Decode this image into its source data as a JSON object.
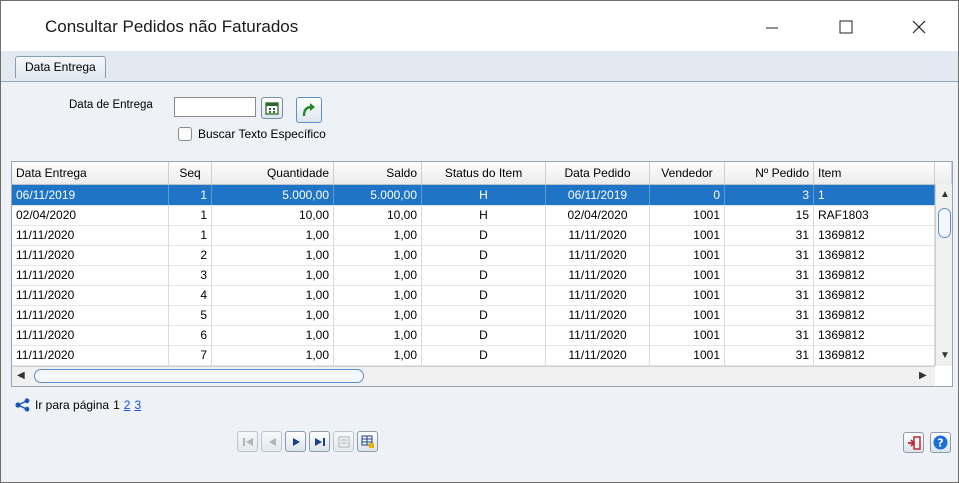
{
  "window": {
    "title": "Consultar Pedidos não Faturados"
  },
  "tabs": [
    {
      "label": "Data Entrega"
    }
  ],
  "filter": {
    "date_label": "Data de Entrega",
    "date_value": "",
    "checkbox_label": "Buscar Texto Específico",
    "checkbox_checked": false
  },
  "grid": {
    "columns": [
      "Data Entrega",
      "Seq",
      "Quantidade",
      "Saldo",
      "Status do Item",
      "Data Pedido",
      "Vendedor",
      "Nº Pedido",
      "Item"
    ],
    "rows": [
      [
        "06/11/2019",
        "1",
        "5.000,00",
        "5.000,00",
        "H",
        "06/11/2019",
        "0",
        "3",
        "1"
      ],
      [
        "02/04/2020",
        "1",
        "10,00",
        "10,00",
        "H",
        "02/04/2020",
        "1001",
        "15",
        "RAF1803"
      ],
      [
        "11/11/2020",
        "1",
        "1,00",
        "1,00",
        "D",
        "11/11/2020",
        "1001",
        "31",
        "1369812"
      ],
      [
        "11/11/2020",
        "2",
        "1,00",
        "1,00",
        "D",
        "11/11/2020",
        "1001",
        "31",
        "1369812"
      ],
      [
        "11/11/2020",
        "3",
        "1,00",
        "1,00",
        "D",
        "11/11/2020",
        "1001",
        "31",
        "1369812"
      ],
      [
        "11/11/2020",
        "4",
        "1,00",
        "1,00",
        "D",
        "11/11/2020",
        "1001",
        "31",
        "1369812"
      ],
      [
        "11/11/2020",
        "5",
        "1,00",
        "1,00",
        "D",
        "11/11/2020",
        "1001",
        "31",
        "1369812"
      ],
      [
        "11/11/2020",
        "6",
        "1,00",
        "1,00",
        "D",
        "11/11/2020",
        "1001",
        "31",
        "1369812"
      ],
      [
        "11/11/2020",
        "7",
        "1,00",
        "1,00",
        "D",
        "11/11/2020",
        "1001",
        "31",
        "1369812"
      ]
    ],
    "selected_row": 0
  },
  "pager": {
    "label": "Ir para página",
    "current": "1",
    "pages": [
      "2",
      "3"
    ]
  },
  "icons": {
    "calendar": "calendar-icon",
    "go": "green-arrow-icon",
    "first": "first-record-icon",
    "prev": "previous-record-icon",
    "next": "next-record-icon",
    "last": "last-record-icon",
    "form": "form-view-icon",
    "grid": "grid-view-icon",
    "exit": "exit-icon",
    "help": "help-icon"
  },
  "colors": {
    "selection": "#1f74c6",
    "accent": "#1a4fd6",
    "exit": "#c0282d"
  }
}
